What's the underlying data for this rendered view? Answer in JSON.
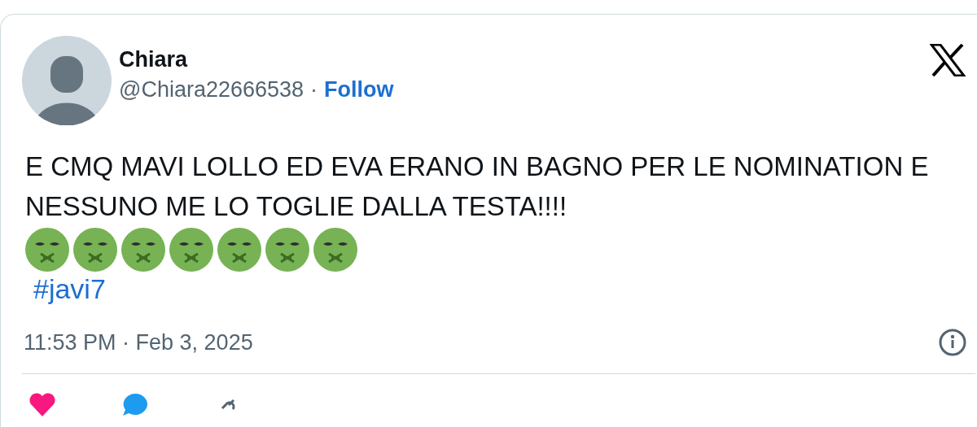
{
  "author": {
    "name": "Chiara",
    "handle": "@Chiara22666538",
    "separator": "·",
    "follow": "Follow"
  },
  "text": "E CMQ MAVI LOLLO ED EVA ERANO IN BAGNO PER LE NOMINATION E NESSUNO ME LO TOGLIE DALLA TESTA!!!!",
  "emojis": [
    {
      "kind": "nauseated"
    },
    {
      "kind": "nauseated"
    },
    {
      "kind": "nauseated"
    },
    {
      "kind": "nauseated"
    },
    {
      "kind": "nauseated"
    },
    {
      "kind": "nauseated"
    },
    {
      "kind": "nauseated"
    }
  ],
  "hashtag": "#javi7",
  "timestamp": "11:53 PM · Feb 3, 2025",
  "actions": [
    {
      "kind": "like"
    },
    {
      "kind": "reply"
    },
    {
      "kind": "copy"
    }
  ]
}
